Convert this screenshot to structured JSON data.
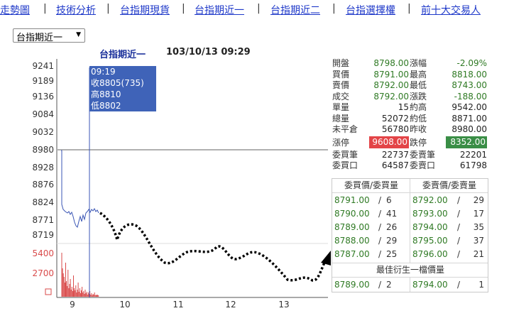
{
  "nav": [
    {
      "label": "走勢圖"
    },
    {
      "label": "技術分析"
    },
    {
      "label": "台指期現貨"
    },
    {
      "label": "台指期近一"
    },
    {
      "label": "台指期近二"
    },
    {
      "label": "台指選擇權"
    },
    {
      "label": "前十大交易人"
    }
  ],
  "nav_sep": "|",
  "select": {
    "value": "台指期近一",
    "arrow": "▼"
  },
  "chart_title": "台指期近一",
  "chart_date": "103/10/13 09:29",
  "y_ticks": [
    "9241",
    "9189",
    "9136",
    "9084",
    "9032",
    "8980",
    "8928",
    "8876",
    "8824",
    "8771",
    "8719"
  ],
  "vol_ticks": [
    "5400",
    "2700"
  ],
  "x_ticks": [
    "9",
    "10",
    "11",
    "12",
    "13"
  ],
  "tooltip": {
    "time": "09:19",
    "close": "收8805(735)",
    "high": "高8810",
    "low": "低8802"
  },
  "info": [
    {
      "l1": "開盤",
      "v1": "8798.00",
      "l2": "漲幅",
      "v2": "-2.09%"
    },
    {
      "l1": "買價",
      "v1": "8791.00",
      "l2": "最高",
      "v2": "8818.00"
    },
    {
      "l1": "賣價",
      "v1": "8792.00",
      "l2": "最低",
      "v2": "8743.00"
    },
    {
      "l1": "成交",
      "v1": "8792.00",
      "l2": "漲跌",
      "v2": "-188.00"
    },
    {
      "l1": "單量",
      "v1": "15",
      "l2": "約高",
      "v2": "9542.00"
    },
    {
      "l1": "總量",
      "v1": "52072",
      "l2": "約低",
      "v2": "8871.00"
    },
    {
      "l1": "未平倉",
      "v1": "56780",
      "l2": "昨收",
      "v2": "8980.00"
    },
    {
      "l1": "漲停",
      "v1": "9608.00",
      "l2": "跌停",
      "v2": "8352.00"
    },
    {
      "l1": "委買筆",
      "v1": "22737",
      "l2": "委賣筆",
      "v2": "22201"
    },
    {
      "l1": "委買口",
      "v1": "64587",
      "l2": "委賣口",
      "v2": "61798"
    }
  ],
  "orderbook": {
    "bid_header": "委買價/委買量",
    "ask_header": "委賣價/委賣量",
    "rows": [
      {
        "bid": "8791.00",
        "bq": "6",
        "ask": "8792.00",
        "aq": "29"
      },
      {
        "bid": "8790.00",
        "bq": "41",
        "ask": "8793.00",
        "aq": "17"
      },
      {
        "bid": "8789.00",
        "bq": "26",
        "ask": "8794.00",
        "aq": "35"
      },
      {
        "bid": "8788.00",
        "bq": "29",
        "ask": "8795.00",
        "aq": "37"
      },
      {
        "bid": "8787.00",
        "bq": "25",
        "ask": "8796.00",
        "aq": "21"
      }
    ],
    "best_header": "最佳衍生一檔價量",
    "best": {
      "bid": "8789.00",
      "bq": "2",
      "ask": "8794.00",
      "aq": "1"
    },
    "slash": "/"
  },
  "colors": {
    "nav": "#1f39c9",
    "price_line": "#3a55b4",
    "volume": "#d94a4a",
    "tooltip_bg": "#3f63b8",
    "ref_line": "#b0b0b0",
    "green": "#2f7a24",
    "red_box": "#e34447",
    "green_box": "#3a8e46"
  }
}
